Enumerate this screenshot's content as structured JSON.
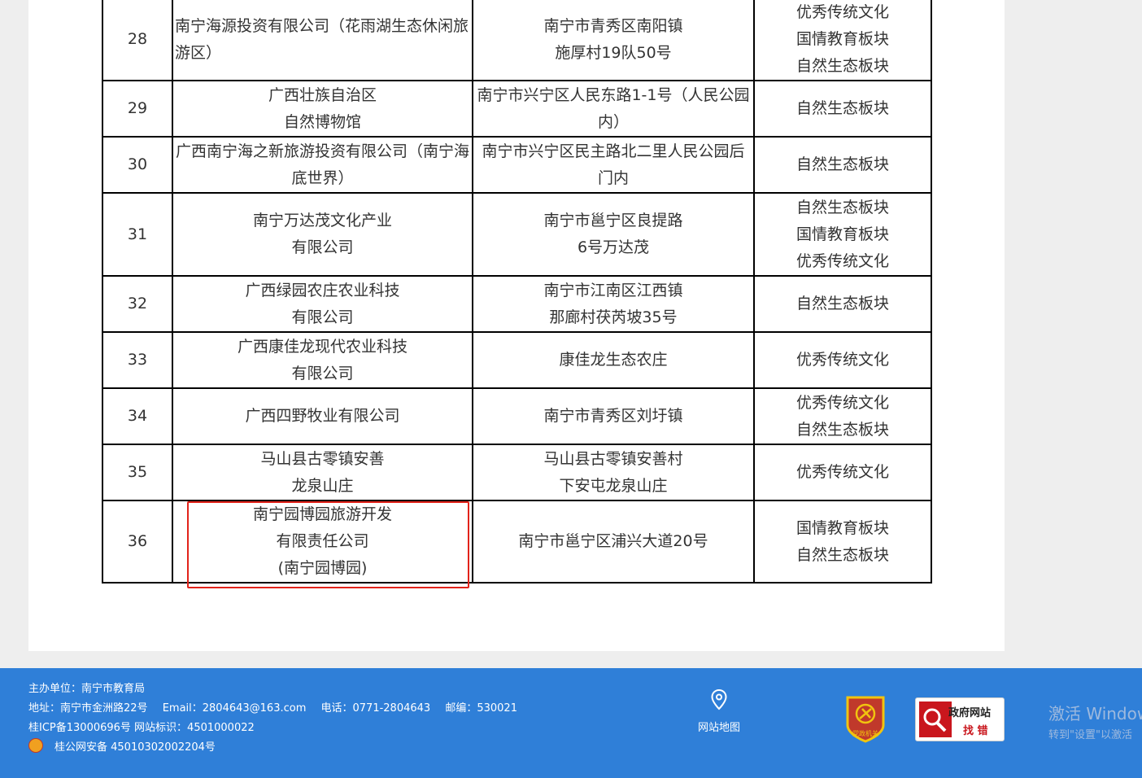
{
  "table": {
    "rows": [
      {
        "num": "28",
        "org": "南宁海源投资有限公司（花雨湖生态休闲旅游区）",
        "address": "南宁市青秀区南阳镇\n施厚村19队50号",
        "category": "优秀传统文化\n国情教育板块\n自然生态板块"
      },
      {
        "num": "29",
        "org": "广西壮族自治区\n自然博物馆",
        "address": "南宁市兴宁区人民东路1-1号（人民公园内）",
        "category": "自然生态板块"
      },
      {
        "num": "30",
        "org": "广西南宁海之新旅游投资有限公司（南宁海底世界）",
        "address": "南宁市兴宁区民主路北二里人民公园后门内",
        "category": "自然生态板块"
      },
      {
        "num": "31",
        "org": "南宁万达茂文化产业\n有限公司",
        "address": "南宁市邕宁区良提路\n6号万达茂",
        "category": "自然生态板块\n国情教育板块\n优秀传统文化"
      },
      {
        "num": "32",
        "org": "广西绿园农庄农业科技\n有限公司",
        "address": "南宁市江南区江西镇\n那廊村茯芮坡35号",
        "category": "自然生态板块"
      },
      {
        "num": "33",
        "org": "广西康佳龙现代农业科技\n有限公司",
        "address": "康佳龙生态农庄",
        "category": "优秀传统文化"
      },
      {
        "num": "34",
        "org": "广西四野牧业有限公司",
        "address": "南宁市青秀区刘圩镇",
        "category": "优秀传统文化\n自然生态板块"
      },
      {
        "num": "35",
        "org": "马山县古零镇安善\n龙泉山庄",
        "address": "马山县古零镇安善村\n下安屯龙泉山庄",
        "category": "优秀传统文化"
      },
      {
        "num": "36",
        "org": "南宁园博园旅游开发\n有限责任公司\n(南宁园博园)",
        "address": "南宁市邕宁区浦兴大道20号",
        "category": "国情教育板块\n自然生态板块"
      }
    ]
  },
  "footer": {
    "sponsor": "主办单位：南宁市教育局",
    "address": "地址：南宁市金洲路22号",
    "email": "Email：2804643@163.com",
    "phone": "电话：0771-2804643",
    "postcode": "邮编：530021",
    "icp": "桂ICP备13000696号 网站标识：4501000022",
    "police": "桂公网安备 45010302002204号",
    "sitemap_label": "网站地图",
    "party_badge_text": "党政机关",
    "gov_error_title": "政府网站",
    "gov_error_sub": "找 错"
  },
  "windows_activation": {
    "title": "激活 Window",
    "subtitle": "转到\"设置\"以激活"
  },
  "colors": {
    "footer_bg": "#2f7fd8",
    "highlight": "#e2231a",
    "party_badge": "#c0392b"
  }
}
